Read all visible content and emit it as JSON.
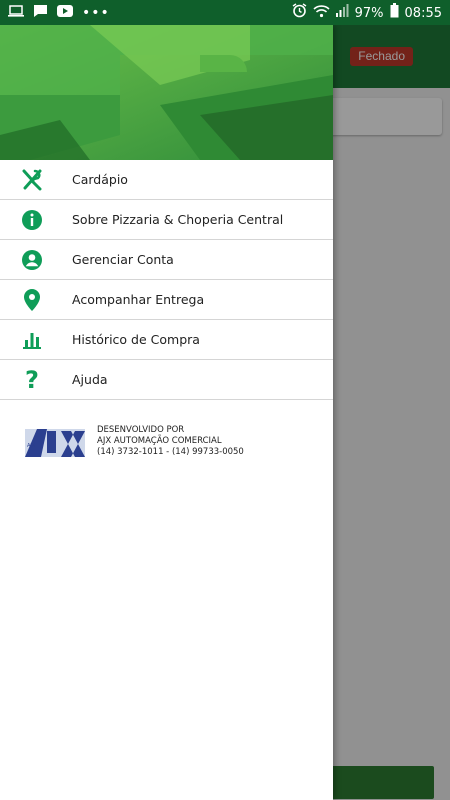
{
  "status_bar": {
    "battery": "97%",
    "time": "08:55"
  },
  "header_status_badge": "Fechado",
  "menu": [
    {
      "label": "Cardápio",
      "icon": "fork-knife-icon"
    },
    {
      "label": "Sobre Pizzaria & Choperia Central",
      "icon": "info-icon"
    },
    {
      "label": "Gerenciar Conta",
      "icon": "account-icon"
    },
    {
      "label": "Acompanhar Entrega",
      "icon": "map-pin-icon"
    },
    {
      "label": "Histórico de Compra",
      "icon": "bar-chart-icon"
    },
    {
      "label": "Ajuda",
      "icon": "question-icon"
    }
  ],
  "footer": {
    "logo_text": "AJX",
    "line1": "DESENVOLVIDO POR",
    "line2": "AJX AUTOMAÇÃO COMERCIAL",
    "line3": "(14) 3732-1011 - (14) 99733-0050"
  },
  "colors": {
    "brand_green": "#0f9d58",
    "toolbar_green": "#1f7a3a",
    "status_bar": "#0f5f2b",
    "badge_red": "#c0392b"
  }
}
